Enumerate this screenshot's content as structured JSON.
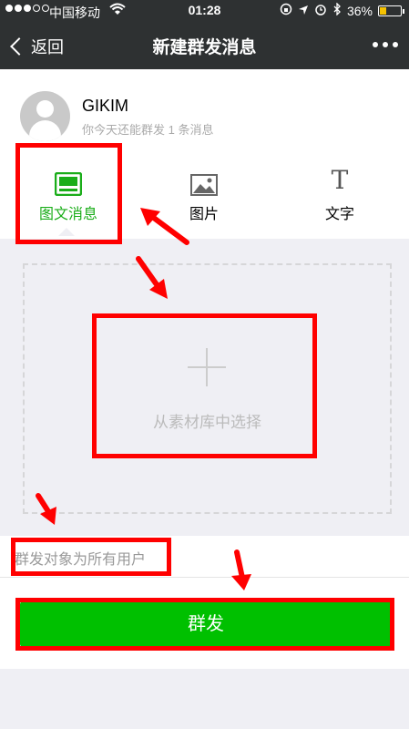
{
  "status_bar": {
    "carrier": "中国移动",
    "time": "01:28",
    "battery": "36%",
    "battery_level": 0.36
  },
  "nav": {
    "back_label": "返回",
    "title": "新建群发消息"
  },
  "account": {
    "name": "GIKIM",
    "quota_text": "你今天还能群发 1 条消息"
  },
  "tabs": [
    {
      "label": "图文消息",
      "icon": "news-icon",
      "active": true
    },
    {
      "label": "图片",
      "icon": "image-icon",
      "active": false
    },
    {
      "label": "文字",
      "icon": "text-icon",
      "glyph": "T",
      "active": false
    }
  ],
  "upload": {
    "label": "从素材库中选择"
  },
  "target_text": "群发对象为所有用户",
  "send_label": "群发",
  "colors": {
    "nav_bg": "#2e3132",
    "accent": "#1aad19",
    "button": "#00c000",
    "annotation": "#ff0000"
  }
}
